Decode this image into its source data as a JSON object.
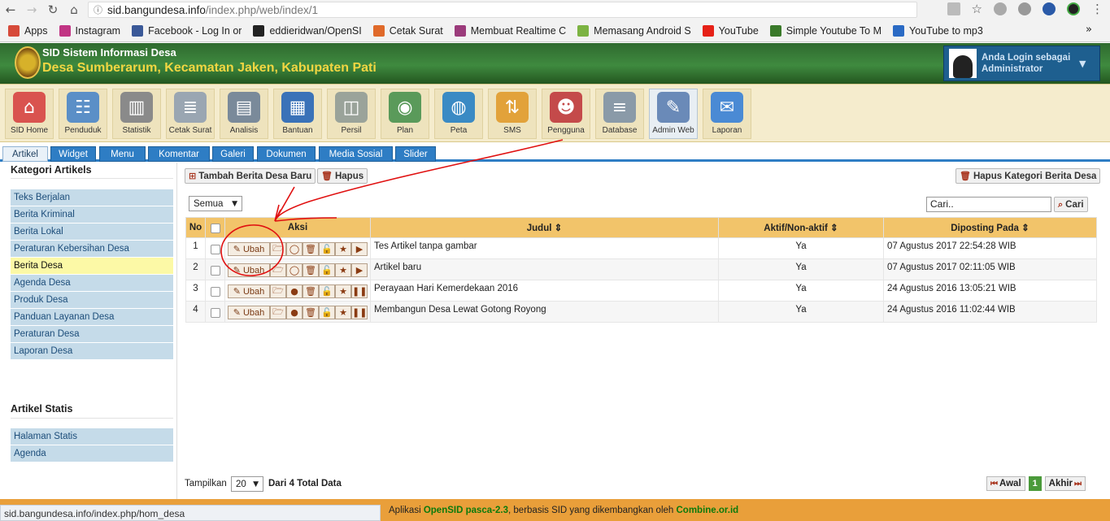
{
  "browser": {
    "url_host": "sid.bangundesa.info",
    "url_path": "/index.php/web/index/1",
    "bookmarks": [
      {
        "label": "Apps",
        "color": "#d64a3a"
      },
      {
        "label": "Instagram",
        "color": "#c13584"
      },
      {
        "label": "Facebook - Log In or",
        "color": "#3b5998"
      },
      {
        "label": "eddieridwan/OpenSI",
        "color": "#222222"
      },
      {
        "label": "Cetak Surat",
        "color": "#e06a2a"
      },
      {
        "label": "Membuat Realtime C",
        "color": "#9b3b7b"
      },
      {
        "label": "Memasang Android S",
        "color": "#7cb342"
      },
      {
        "label": "YouTube",
        "color": "#e62117"
      },
      {
        "label": "Simple Youtube To M",
        "color": "#3a7a2a"
      },
      {
        "label": "YouTube to mp3",
        "color": "#2a6ac4"
      }
    ],
    "more": "»"
  },
  "header": {
    "title": "SID Sistem Informasi Desa",
    "subtitle": "Desa Sumberarum, Kecamatan Jaken, Kabupaten Pati",
    "login_line1": "Anda Login sebagai",
    "login_line2": "Administrator"
  },
  "modules": [
    {
      "label": "SID Home",
      "icon": "home-icon",
      "color": "#d9534f",
      "glyph": "⌂"
    },
    {
      "label": "Penduduk",
      "icon": "residents-icon",
      "color": "#5b8fc7",
      "glyph": "☷"
    },
    {
      "label": "Statistik",
      "icon": "statistics-icon",
      "color": "#8a8a8a",
      "glyph": "▥"
    },
    {
      "label": "Cetak Surat",
      "icon": "print-letter-icon",
      "color": "#9aa6b2",
      "glyph": "≣"
    },
    {
      "label": "Analisis",
      "icon": "analysis-icon",
      "color": "#7a8a9a",
      "glyph": "▤"
    },
    {
      "label": "Bantuan",
      "icon": "help-icon",
      "color": "#3a72b8",
      "glyph": "▦"
    },
    {
      "label": "Persil",
      "icon": "parcel-map-icon",
      "color": "#9aa39a",
      "glyph": "◫"
    },
    {
      "label": "Plan",
      "icon": "plan-icon",
      "color": "#5a9a5a",
      "glyph": "◉"
    },
    {
      "label": "Peta",
      "icon": "globe-icon",
      "color": "#3a8ac4",
      "glyph": "◍"
    },
    {
      "label": "SMS",
      "icon": "sms-icon",
      "color": "#e2a23a",
      "glyph": "⇅"
    },
    {
      "label": "Pengguna",
      "icon": "users-icon",
      "color": "#c44a4a",
      "glyph": "☻"
    },
    {
      "label": "Database",
      "icon": "database-icon",
      "color": "#8a9aa8",
      "glyph": "≡"
    },
    {
      "label": "Admin Web",
      "icon": "admin-web-icon",
      "color": "#6a8ab8",
      "glyph": "✎"
    },
    {
      "label": "Laporan",
      "icon": "report-icon",
      "color": "#4a8ad4",
      "glyph": "✉"
    }
  ],
  "tabs": [
    "Artikel",
    "Widget",
    "Menu",
    "Komentar",
    "Galeri",
    "Dokumen",
    "Media Sosial",
    "Slider"
  ],
  "sidebar": {
    "heading1": "Kategori Artikels",
    "categories": [
      "Teks Berjalan",
      "Berita Kriminal",
      "Berita Lokal",
      "Peraturan Kebersihan Desa",
      "Berita Desa",
      "Agenda Desa",
      "Produk Desa",
      "Panduan Layanan Desa",
      "Peraturan Desa",
      "Laporan Desa"
    ],
    "heading2": "Artikel Statis",
    "static_pages": [
      "Halaman Statis",
      "Agenda"
    ]
  },
  "toolbar": {
    "add_label": "Tambah Berita Desa Baru",
    "delete_label": "Hapus",
    "delete_category_label": "Hapus Kategori Berita Desa",
    "filter_value": "Semua",
    "search_placeholder": "Cari..",
    "search_button": "Cari"
  },
  "table": {
    "headers": {
      "no": "No",
      "aksi": "Aksi",
      "judul": "Judul ⇕",
      "aktif": "Aktif/Non-aktif ⇕",
      "diposting": "Diposting Pada ⇕"
    },
    "edit_label": "Ubah",
    "rows": [
      {
        "no": "1",
        "judul": "Tes Artikel tanpa gambar",
        "aktif": "Ya",
        "tanggal": "07 Agustus 2017 22:54:28 WIB"
      },
      {
        "no": "2",
        "judul": "Artikel baru",
        "aktif": "Ya",
        "tanggal": "07 Agustus 2017 02:11:05 WIB"
      },
      {
        "no": "3",
        "judul": "Perayaan Hari Kemerdekaan 2016",
        "aktif": "Ya",
        "tanggal": "24 Agustus 2016 13:05:21 WIB"
      },
      {
        "no": "4",
        "judul": "Membangun Desa Lewat Gotong Royong",
        "aktif": "Ya",
        "tanggal": "24 Agustus 2016 11:02:44 WIB"
      }
    ]
  },
  "pagination": {
    "show_label": "Tampilkan",
    "per_page": "20",
    "total_label": "Dari 4 Total Data",
    "first": "Awal",
    "current": "1",
    "last": "Akhir"
  },
  "footer": {
    "prefix": "Aplikasi ",
    "app": "OpenSID pasca-2.3",
    "middle": ", berbasis SID yang dikembangkan oleh ",
    "org": "Combine.or.id"
  },
  "statusbar": "sid.bangundesa.info/index.php/hom_desa"
}
